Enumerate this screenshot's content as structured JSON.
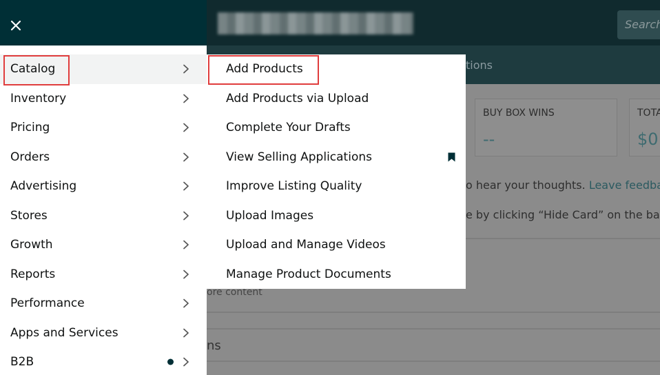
{
  "header": {
    "search_placeholder": "Search"
  },
  "background": {
    "nav_text": "tions",
    "cards": [
      {
        "label": "BUY BOX WINS",
        "value": "--"
      },
      {
        "label": "TOTA",
        "value": "$0."
      }
    ],
    "feedback_prefix": "o hear your thoughts. ",
    "feedback_link": "Leave feedbac",
    "hide_card_text": "e by clicking “Hide Card” on the back",
    "more_content": "ore content",
    "section_tail": "ns"
  },
  "menu": {
    "items": [
      {
        "label": "Catalog"
      },
      {
        "label": "Inventory"
      },
      {
        "label": "Pricing"
      },
      {
        "label": "Orders"
      },
      {
        "label": "Advertising"
      },
      {
        "label": "Stores"
      },
      {
        "label": "Growth"
      },
      {
        "label": "Reports"
      },
      {
        "label": "Performance"
      },
      {
        "label": "Apps and Services"
      },
      {
        "label": "B2B"
      }
    ]
  },
  "submenu": {
    "items": [
      {
        "label": "Add Products"
      },
      {
        "label": "Add Products via Upload"
      },
      {
        "label": "Complete Your Drafts"
      },
      {
        "label": "View Selling Applications"
      },
      {
        "label": "Improve Listing Quality"
      },
      {
        "label": "Upload Images"
      },
      {
        "label": "Upload and Manage Videos"
      },
      {
        "label": "Manage Product Documents"
      }
    ]
  },
  "colors": {
    "drawer_header": "#002f36",
    "highlight_box": "#e03c3c",
    "active_row": "#f2f3f3"
  },
  "icons": {
    "close": "close-icon",
    "chevron": "chevron-right-icon",
    "bookmark": "bookmark-icon",
    "dot": "notification-dot-icon"
  }
}
